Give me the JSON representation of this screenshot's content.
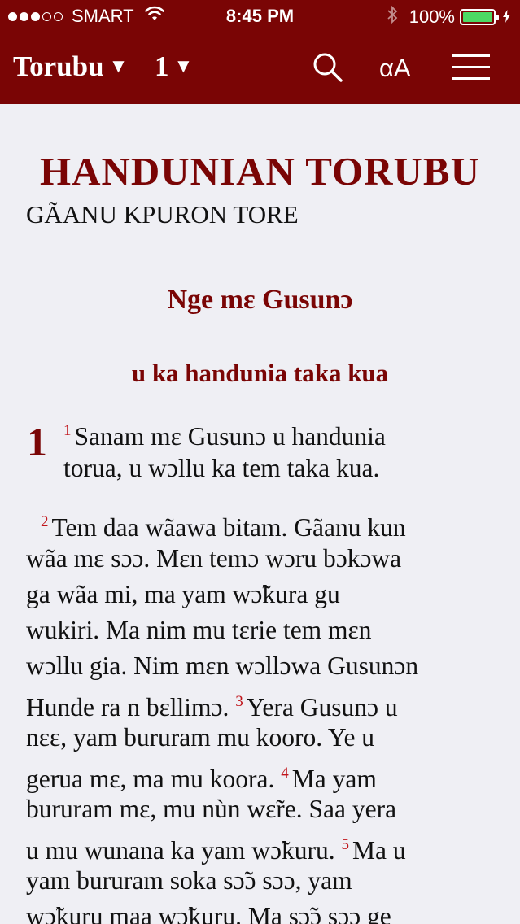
{
  "status_bar": {
    "carrier": "SMART",
    "signal_filled": 3,
    "signal_total": 5,
    "time": "8:45 PM",
    "battery_percent": "100%",
    "battery_level": 1.0
  },
  "navbar": {
    "book": "Torubu",
    "chapter": "1",
    "caret": "▼",
    "font_button": "αA",
    "icons": [
      "search-icon",
      "menu-icon"
    ]
  },
  "content": {
    "book_title": "HANDUNIAN TORUBU",
    "book_subtitle": "GÃANU KPURON TORE",
    "heading1": "Nge mɛ Gusunɔ",
    "heading2": "u ka handunia taka kua",
    "chapter_number": "1",
    "lines": [
      {
        "verse": "1",
        "text": "Sanam mɛ Gusunɔ u handunia"
      },
      {
        "verse": "",
        "text": "torua, u wɔllu ka tem taka kua."
      },
      {
        "verse": "2",
        "text": "Tem daa wãawa bitam. Gãanu kun"
      },
      {
        "verse": "",
        "text": "wãa mɛ sɔɔ. Mɛn temɔ wɔru bɔkɔwa"
      },
      {
        "verse": "",
        "text": "ga wãa mi, ma yam wɔ̃kura gu"
      },
      {
        "verse": "",
        "text": "wukiri. Ma nim mu tɛrie tem mɛn"
      },
      {
        "verse": "",
        "text": "wɔllu gia. Nim mɛn wɔllɔwa Gusunɔn"
      },
      {
        "verse": "",
        "text": "Hunde ra n bɛllimɔ.",
        "verse2": "3",
        "text2": "Yera Gusunɔ u"
      },
      {
        "verse": "",
        "text": "nɛɛ, yam bururam mu kooro. Ye u"
      },
      {
        "verse": "",
        "text": "gerua mɛ, ma mu koora.",
        "verse2": "4",
        "text2": "Ma yam"
      },
      {
        "verse": "",
        "text": "bururam mɛ, mu nùn wɛ̃re. Saa yera"
      },
      {
        "verse": "",
        "text": "u mu wunana ka yam wɔ̃kuru.",
        "verse2": "5",
        "text2": "Ma u"
      },
      {
        "verse": "",
        "text": "yam bururam soka sɔ̃ɔ sɔɔ, yam"
      },
      {
        "verse": "",
        "text": "wɔ̃kuru maa wɔ̃kuru. Ma sɔ̃ɔ sɔɔ ge"
      }
    ]
  }
}
